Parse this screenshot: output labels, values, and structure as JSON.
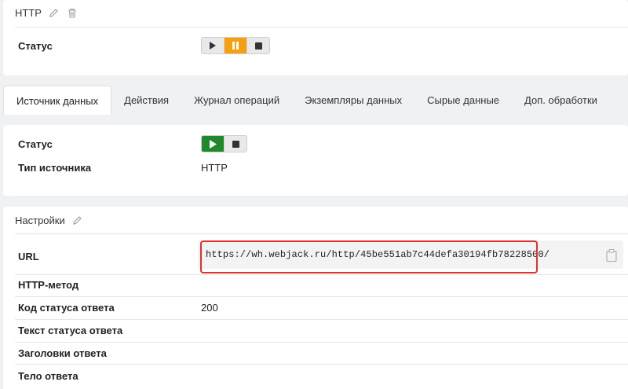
{
  "header": {
    "title": "HTTP",
    "edit_icon": "pencil-icon",
    "delete_icon": "trash-icon"
  },
  "top_status": {
    "label": "Статус",
    "controls": [
      "play-icon",
      "pause-icon",
      "stop-icon"
    ],
    "active": "pause"
  },
  "tabs": [
    {
      "label": "Источник данных",
      "active": true
    },
    {
      "label": "Действия"
    },
    {
      "label": "Журнал операций"
    },
    {
      "label": "Экземпляры данных"
    },
    {
      "label": "Сырые данные"
    },
    {
      "label": "Доп. обработки"
    }
  ],
  "source": {
    "status_label": "Статус",
    "controls": [
      "play-icon",
      "stop-icon"
    ],
    "active": "play",
    "type_label": "Тип источника",
    "type_value": "HTTP"
  },
  "settings": {
    "title": "Настройки",
    "url_label": "URL",
    "url_value": "https://wh.webjack.ru/http/45be551ab7c44defa30194fb78228500/",
    "method_label": "HTTP-метод",
    "method_value": "",
    "code_label": "Код статуса ответа",
    "code_value": "200",
    "status_text_label": "Текст статуса ответа",
    "headers_label": "Заголовки ответа",
    "body_label": "Тело ответа"
  },
  "colors": {
    "accent_orange": "#f5a00f",
    "accent_green": "#1e8a2b",
    "highlight_red": "#e03030"
  }
}
